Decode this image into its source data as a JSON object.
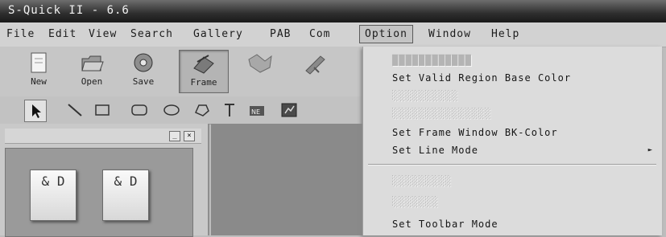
{
  "window": {
    "title": "S-Quick II - 6.6"
  },
  "menubar": {
    "items": [
      "File",
      "Edit",
      "View",
      "Search",
      "Gallery",
      "PAB",
      "Com",
      "Option",
      "Window",
      "Help"
    ]
  },
  "toolbar": {
    "buttons": [
      {
        "label": "New",
        "icon": "new-file-icon"
      },
      {
        "label": "Open",
        "icon": "open-folder-icon"
      },
      {
        "label": "Save",
        "icon": "save-icon"
      },
      {
        "label": "Frame",
        "icon": "frame-icon",
        "pressed": true
      }
    ]
  },
  "drawing_tools": [
    "pointer",
    "line",
    "rectangle",
    "rounded-rectangle",
    "ellipse",
    "polygon",
    "text",
    "image",
    "icon"
  ],
  "option_menu": {
    "items": [
      {
        "label": "",
        "disabled": true
      },
      {
        "label": "Set Valid Region Base Color",
        "disabled": false
      },
      {
        "label": "",
        "disabled": true
      },
      {
        "label": "",
        "disabled": true
      },
      {
        "label": "Set Frame Window BK-Color",
        "disabled": false
      },
      {
        "label": "Set  Line Mode",
        "disabled": false,
        "submenu": true
      },
      {
        "label": "",
        "disabled": true
      },
      {
        "label": "",
        "disabled": true
      },
      {
        "label": "Set Toolbar Mode",
        "disabled": false
      }
    ]
  },
  "panel": {
    "symbols": [
      "& D",
      "& D"
    ]
  },
  "colors": {
    "menu_bg": "#dcdcdc",
    "title_bg": "#2e2e2e",
    "work_area": "#8a8a8a"
  }
}
